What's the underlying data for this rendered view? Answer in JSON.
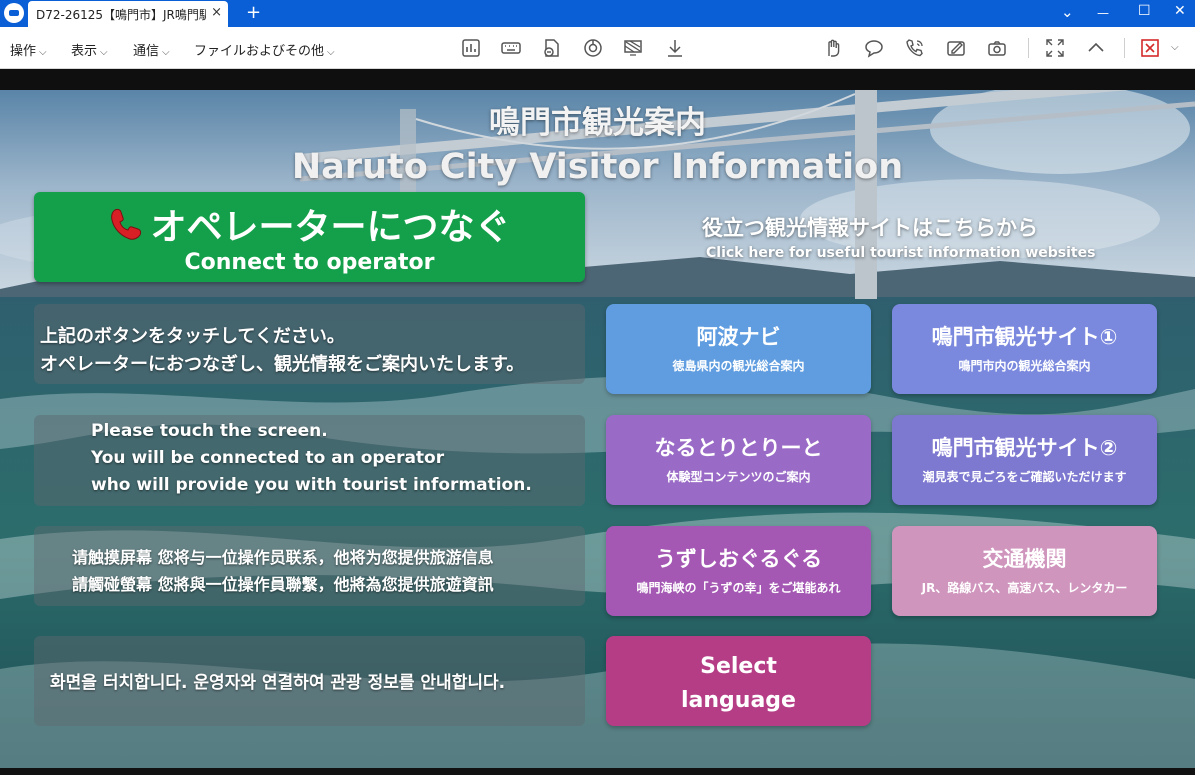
{
  "window": {
    "tab_title": "D72-26125【鳴門市】JR鳴門駅...",
    "tab_close": "×",
    "new_tab": "+",
    "controls": {
      "chevron": "⌄",
      "minimize": "—",
      "maximize": "☐",
      "close": "✕"
    }
  },
  "menubar": {
    "items": [
      {
        "label": "操作"
      },
      {
        "label": "表示"
      },
      {
        "label": "通信"
      },
      {
        "label": "ファイルおよびその他"
      }
    ],
    "chevron": "⌵",
    "toolbar_icons": [
      "stats-icon",
      "keyboard-icon",
      "file-transfer-icon",
      "power-icon",
      "screen-blank-icon",
      "download-icon",
      "hand-icon",
      "chat-icon",
      "phone-icon",
      "whiteboard-icon",
      "camera-icon",
      "fullscreen-icon",
      "collapse-icon",
      "end-session-icon"
    ]
  },
  "remote": {
    "title_ja": "鳴門市観光案内",
    "title_en": "Naruto City Visitor Information",
    "connect": {
      "phone_icon": "phone-icon",
      "label_ja": "オペレーターにつなぐ",
      "label_en": "Connect to operator"
    },
    "info_heading_ja": "役立つ観光情報サイトはこちらから",
    "info_heading_en": "Click here for useful tourist information websites",
    "panel_ja": {
      "line1": "上記のボタンをタッチしてください。",
      "line2": "オペレーターにおつなぎし、観光情報をご案内いたします。"
    },
    "panel_en": {
      "line1": "Please touch the screen.",
      "line2": "You will be connected to an operator",
      "line3": "who will provide you with tourist information."
    },
    "panel_zh": {
      "line1": "请触摸屏幕 您将与一位操作员联系，他将为您提供旅游信息",
      "line2": "請觸碰螢幕 您將與一位操作員聯繫，他將為您提供旅遊資訊"
    },
    "panel_ko": {
      "line1": "화면을 터치합니다. 운영자와 연결하여 관광 정보를 안내합니다."
    },
    "buttons": [
      {
        "title": "阿波ナビ",
        "subtitle": "徳島県内の観光総合案内",
        "color": "#5f9de0"
      },
      {
        "title": "鳴門市観光サイト①",
        "subtitle": "鳴門市内の観光総合案内",
        "color": "#7a88de"
      },
      {
        "title": "なるとりとりーと",
        "subtitle": "体験型コンテンツのご案内",
        "color": "#9a6bc6"
      },
      {
        "title": "鳴門市観光サイト②",
        "subtitle": "潮見表で見ごろをご確認いただけます",
        "color": "#7d78d0"
      },
      {
        "title": "うずしおぐるぐる",
        "subtitle": "鳴門海峡の「うずの幸」をご堪能あれ",
        "color": "#a458b3"
      },
      {
        "title": "交通機関",
        "subtitle": "JR、路線バス、高速バス、レンタカー",
        "color": "#cf95bd"
      }
    ],
    "select_language": {
      "line1": "Select",
      "line2": "language",
      "color": "#b53d86"
    }
  }
}
